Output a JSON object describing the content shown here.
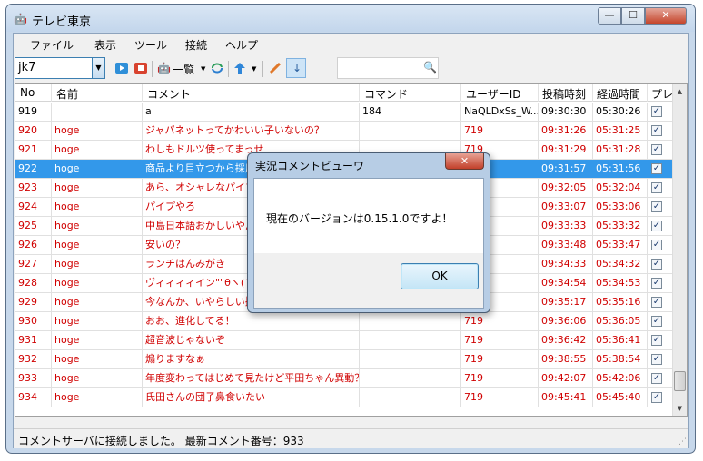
{
  "window": {
    "title": "テレビ東京",
    "icon": "robot-icon",
    "minimize": "—",
    "maximize": "☐",
    "close": "✕"
  },
  "menu": [
    "ファイル",
    "表示",
    "ツール",
    "接続",
    "ヘルプ"
  ],
  "toolbar": {
    "channel": "jk7",
    "list_label": "一覧",
    "search_value": ""
  },
  "columns": [
    "No",
    "名前",
    "コメント",
    "コマンド",
    "ユーザーID",
    "投稿時刻",
    "経過時間",
    "プレ"
  ],
  "rows": [
    {
      "no": "919",
      "name": "",
      "comment": "a",
      "command": "184",
      "uid": "NaQLDxSs_W...",
      "time": "09:30:30",
      "elapsed": "05:30:26",
      "style": "normal"
    },
    {
      "no": "920",
      "name": "hoge",
      "comment": "ジャパネットってかわいい子いないの？",
      "command": "",
      "uid": "719",
      "time": "09:31:26",
      "elapsed": "05:31:25",
      "style": "red"
    },
    {
      "no": "921",
      "name": "hoge",
      "comment": "わしもドルツ使ってまっせ",
      "command": "",
      "uid": "719",
      "time": "09:31:29",
      "elapsed": "05:31:28",
      "style": "red"
    },
    {
      "no": "922",
      "name": "hoge",
      "comment": "商品より目立つから採用",
      "command": "",
      "uid": "",
      "time": "09:31:57",
      "elapsed": "05:31:56",
      "style": "selected"
    },
    {
      "no": "923",
      "name": "hoge",
      "comment": "あら、オシャレなパイプ",
      "command": "",
      "uid": "",
      "time": "09:32:05",
      "elapsed": "05:32:04",
      "style": "red"
    },
    {
      "no": "924",
      "name": "hoge",
      "comment": "パイプやろ",
      "command": "",
      "uid": "",
      "time": "09:33:07",
      "elapsed": "05:33:06",
      "style": "red"
    },
    {
      "no": "925",
      "name": "hoge",
      "comment": "中島日本語おかしいやん",
      "command": "",
      "uid": "",
      "time": "09:33:33",
      "elapsed": "05:33:32",
      "style": "red"
    },
    {
      "no": "926",
      "name": "hoge",
      "comment": "安いの？",
      "command": "",
      "uid": "",
      "time": "09:33:48",
      "elapsed": "05:33:47",
      "style": "red"
    },
    {
      "no": "927",
      "name": "hoge",
      "comment": "ランチはんみがき",
      "command": "",
      "uid": "",
      "time": "09:34:33",
      "elapsed": "05:34:32",
      "style": "red"
    },
    {
      "no": "928",
      "name": "hoge",
      "comment": "ヴィィィィイン\"\"θヽ(´Д",
      "command": "",
      "uid": "",
      "time": "09:34:54",
      "elapsed": "05:34:53",
      "style": "red"
    },
    {
      "no": "929",
      "name": "hoge",
      "comment": "今なんか、いやらしい擬音",
      "command": "",
      "uid": "",
      "time": "09:35:17",
      "elapsed": "05:35:16",
      "style": "red"
    },
    {
      "no": "930",
      "name": "hoge",
      "comment": "おお、進化してる！",
      "command": "",
      "uid": "719",
      "time": "09:36:06",
      "elapsed": "05:36:05",
      "style": "red"
    },
    {
      "no": "931",
      "name": "hoge",
      "comment": "超音波じゃないぞ",
      "command": "",
      "uid": "719",
      "time": "09:36:42",
      "elapsed": "05:36:41",
      "style": "red"
    },
    {
      "no": "932",
      "name": "hoge",
      "comment": "煽りますなぁ",
      "command": "",
      "uid": "719",
      "time": "09:38:55",
      "elapsed": "05:38:54",
      "style": "red"
    },
    {
      "no": "933",
      "name": "hoge",
      "comment": "年度変わってはじめて見たけど平田ちゃん異動？",
      "command": "",
      "uid": "719",
      "time": "09:42:07",
      "elapsed": "05:42:06",
      "style": "red"
    },
    {
      "no": "934",
      "name": "hoge",
      "comment": "氏田さんの団子鼻食いたい",
      "command": "",
      "uid": "719",
      "time": "09:45:41",
      "elapsed": "05:45:40",
      "style": "red"
    }
  ],
  "status": "コメントサーバに接続しました。 最新コメント番号：933",
  "dialog": {
    "title": "実況コメントビューワ",
    "message": "現在のバージョンは0.15.1.0ですよ！",
    "ok": "OK",
    "close": "✕"
  }
}
